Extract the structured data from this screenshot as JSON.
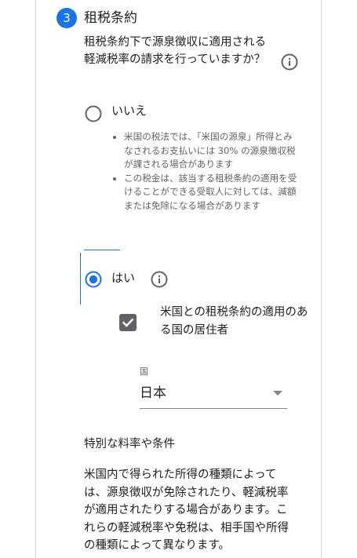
{
  "step": {
    "number": "3",
    "title": "租税条約"
  },
  "question": {
    "text": "租税条約下で源泉徴収に適用される軽減税率の請求を行っていますか？",
    "info_icon": "info-icon"
  },
  "option_no": {
    "label": "いいえ",
    "selected": false,
    "notes": [
      "米国の税法では、「米国の源泉」所得とみなされるお支払いには 30% の源泉徴収税が課される場合があります",
      "この税金は、該当する租税条約の適用を受けることができる受取人に対しては、減額または免除になる場合があります"
    ]
  },
  "option_yes": {
    "label": "はい",
    "selected": true,
    "info_icon": "info-icon"
  },
  "resident_checkbox": {
    "label": "米国との租税条約の適用のある国の居住者",
    "checked": true
  },
  "country_select": {
    "label": "国",
    "value": "日本"
  },
  "special_rates": {
    "heading": "特別な料率や条件",
    "description": "米国内で得られた所得の種類によっては、源泉徴収が免除されたり、軽減税率が適用されたりする場合があります。これらの軽減税率や免税は、相手国や所得の種類によって異なります。"
  },
  "colors": {
    "accent": "#1a73e8",
    "text": "#202124",
    "secondary_text": "#5f6368",
    "divider": "#dadce0"
  }
}
